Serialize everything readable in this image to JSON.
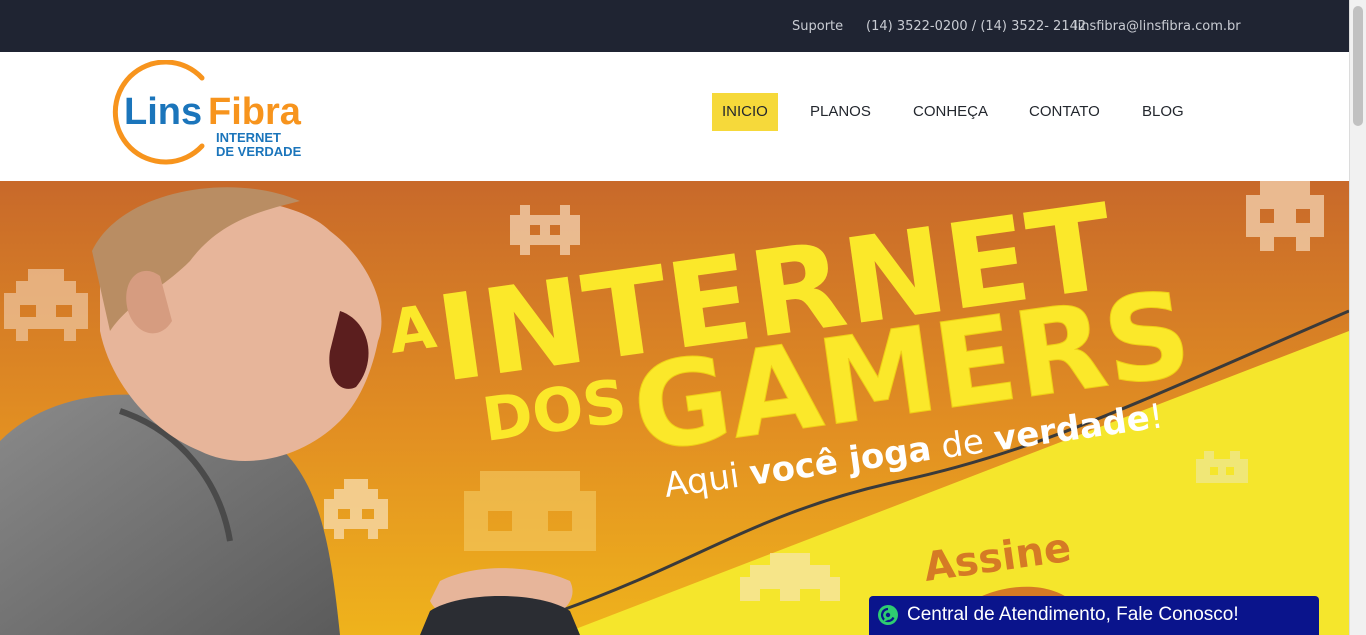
{
  "topbar": {
    "support": "Suporte",
    "phones": "(14) 3522-0200 / (14) 3522- 2142",
    "email": "linsfibra@linsfibra.com.br"
  },
  "logo": {
    "brand_first": "Lins",
    "brand_second": "Fibra",
    "tagline_line1": "INTERNET",
    "tagline_line2": "DE VERDADE",
    "colors": {
      "blue": "#1b75bb",
      "orange": "#f7941d"
    }
  },
  "nav": {
    "items": [
      {
        "label": "INICIO",
        "active": true
      },
      {
        "label": "PLANOS",
        "active": false
      },
      {
        "label": "CONHEÇA",
        "active": false
      },
      {
        "label": "CONTATO",
        "active": false
      },
      {
        "label": "BLOG",
        "active": false
      }
    ],
    "active_color": "#f6d93a"
  },
  "hero": {
    "word_a": "A",
    "word_internet": "INTERNET",
    "word_dos": "DOS",
    "word_gamers": "GAMERS",
    "sub_aqui": "Aqui ",
    "sub_voce_joga": "você joga",
    "sub_de": " de ",
    "sub_verdade": "verdade",
    "sub_bang": "!",
    "assine": "Assine",
    "colors": {
      "orange": "#d57a25",
      "yellow": "#f5e62c",
      "text_yellow": "#fbe82a"
    }
  },
  "chat": {
    "label": "Central de Atendimento, Fale Conosco!",
    "icon": "chat-bubble-icon",
    "background": "#0a148c"
  }
}
